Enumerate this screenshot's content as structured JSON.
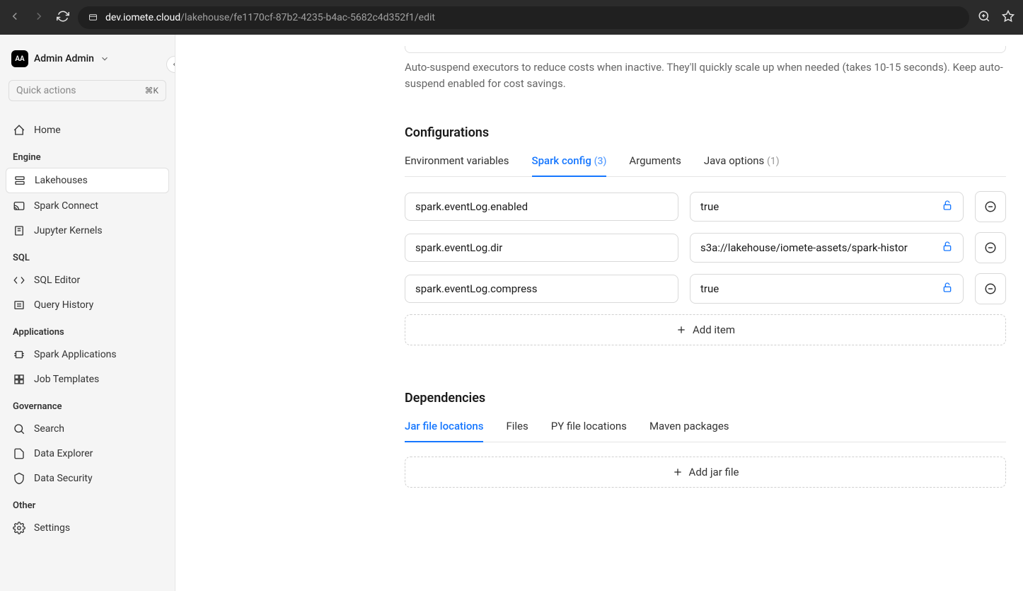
{
  "browser": {
    "url_domain": "dev.iomete.cloud",
    "url_path": "/lakehouse/fe1170cf-87b2-4235-b4ac-5682c4d352f1/edit"
  },
  "user": {
    "initials": "AA",
    "name": "Admin Admin"
  },
  "quick_actions": {
    "placeholder": "Quick actions",
    "kbd": "⌘K"
  },
  "nav": {
    "home": "Home",
    "sections": {
      "engine": {
        "title": "Engine",
        "items": [
          "Lakehouses",
          "Spark Connect",
          "Jupyter Kernels"
        ]
      },
      "sql": {
        "title": "SQL",
        "items": [
          "SQL Editor",
          "Query History"
        ]
      },
      "applications": {
        "title": "Applications",
        "items": [
          "Spark Applications",
          "Job Templates"
        ]
      },
      "governance": {
        "title": "Governance",
        "items": [
          "Search",
          "Data Explorer",
          "Data Security"
        ]
      },
      "other": {
        "title": "Other",
        "items": [
          "Settings"
        ]
      }
    }
  },
  "main": {
    "description": "Auto-suspend executors to reduce costs when inactive. They'll quickly scale up when needed (takes 10-15 seconds). Keep auto-suspend enabled for cost savings.",
    "configurations": {
      "title": "Configurations",
      "tabs": [
        {
          "label": "Environment variables",
          "count": null
        },
        {
          "label": "Spark config",
          "count": "(3)"
        },
        {
          "label": "Arguments",
          "count": null
        },
        {
          "label": "Java options",
          "count": "(1)"
        }
      ],
      "rows": [
        {
          "key": "spark.eventLog.enabled",
          "value": "true"
        },
        {
          "key": "spark.eventLog.dir",
          "value": "s3a://lakehouse/iomete-assets/spark-histor"
        },
        {
          "key": "spark.eventLog.compress",
          "value": "true"
        }
      ],
      "add_label": "Add item"
    },
    "dependencies": {
      "title": "Dependencies",
      "tabs": [
        {
          "label": "Jar file locations"
        },
        {
          "label": "Files"
        },
        {
          "label": "PY file locations"
        },
        {
          "label": "Maven packages"
        }
      ],
      "add_label": "Add jar file"
    }
  }
}
